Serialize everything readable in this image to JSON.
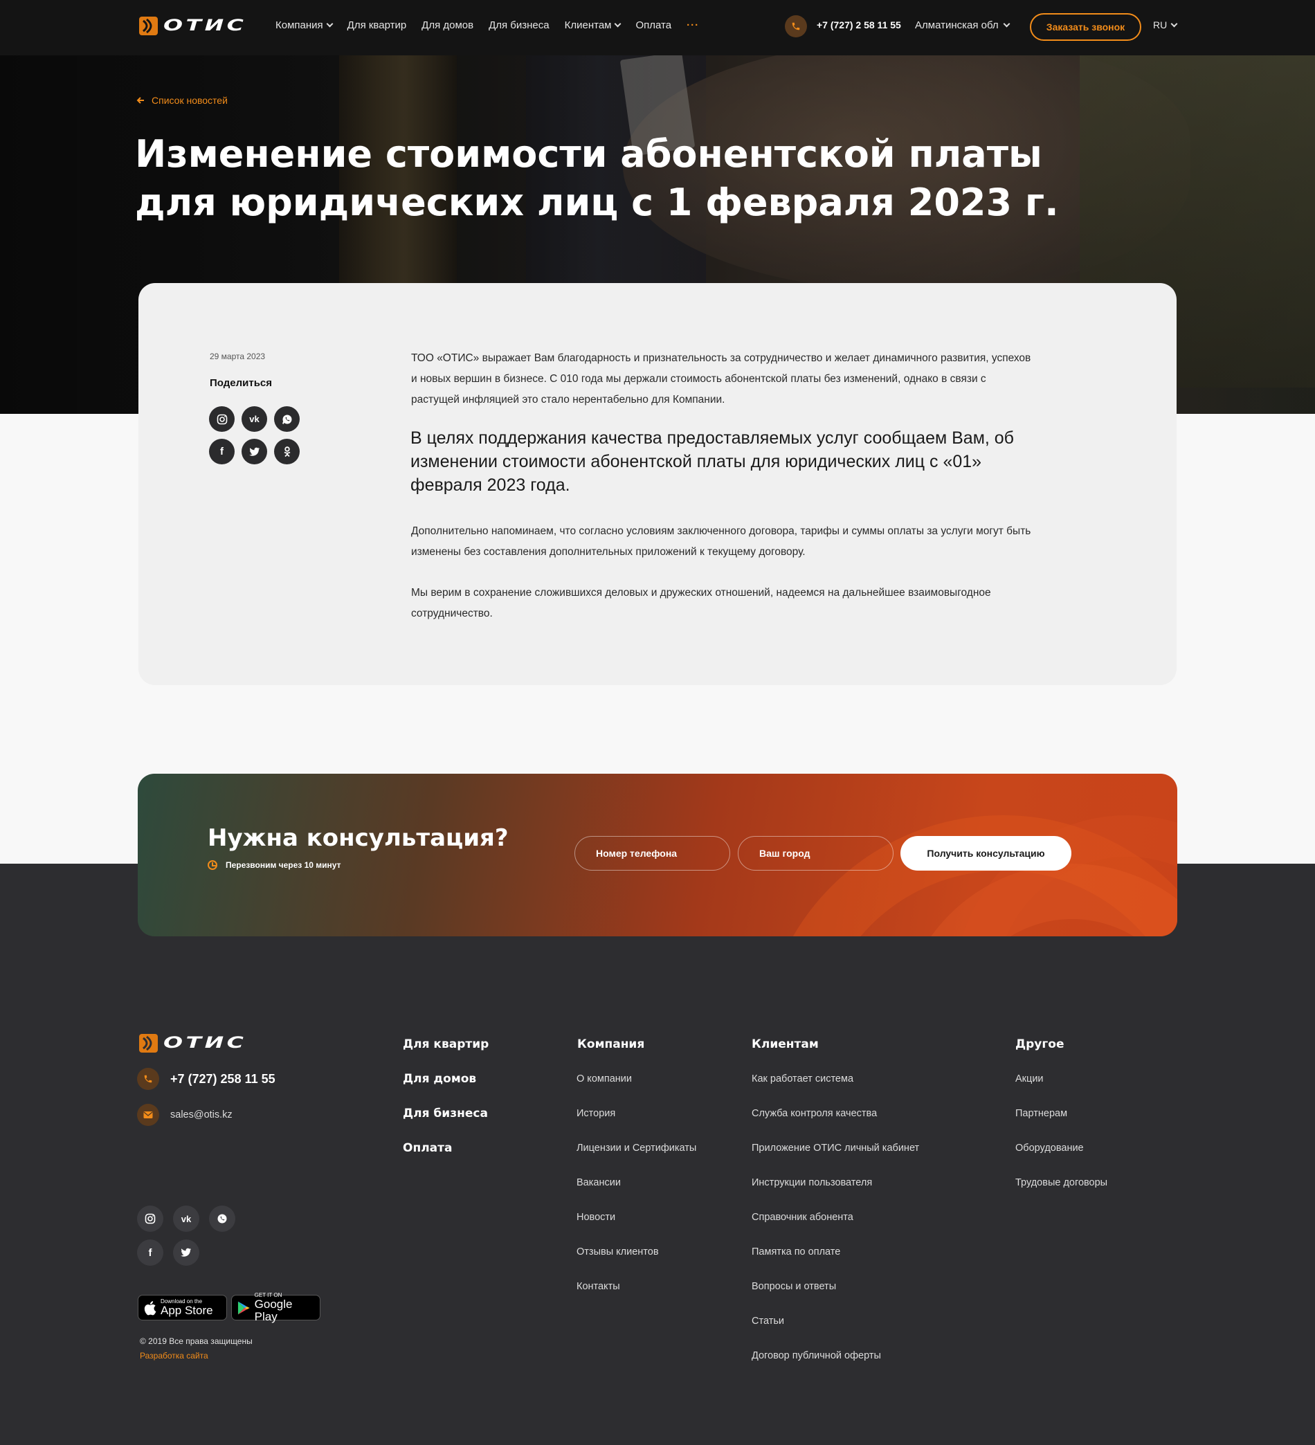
{
  "header": {
    "logo_text": "ОТИС",
    "nav": [
      {
        "label": "Компания",
        "dropdown": true
      },
      {
        "label": "Для квартир",
        "dropdown": false
      },
      {
        "label": "Для домов",
        "dropdown": false
      },
      {
        "label": "Для бизнеса",
        "dropdown": false
      },
      {
        "label": "Клиентам",
        "dropdown": true
      },
      {
        "label": "Оплата",
        "dropdown": false
      }
    ],
    "more": "···",
    "phone": "+7 (727) 2 58 11 55",
    "region": "Алматинская обл",
    "call_button": "Заказать звонок",
    "lang": "RU"
  },
  "hero": {
    "back_link": "Список новостей",
    "title_line1": "Изменение стоимости абонентской платы",
    "title_line2": "для юридических лиц с 1 февраля 2023 г."
  },
  "article": {
    "date": "29 марта 2023",
    "share_title": "Поделиться",
    "share_icons": [
      "instagram-icon",
      "vk-icon",
      "whatsapp-icon",
      "facebook-icon",
      "twitter-icon",
      "odnoklassniki-icon"
    ],
    "p1": "ТОО «ОТИС» выражает Вам благодарность и признательность за сотрудничество и желает динамичного развития, успехов и новых вершин в бизнесе. С 010 года мы держали стоимость абонентской платы без изменений, однако в связи с растущей инфляцией это стало нерентабельно для Компании.",
    "lead": "В целях поддержания качества предоставляемых услуг сообщаем Вам, об изменении стоимости абонентской платы для юридических лиц с «01» февраля 2023 года.",
    "p2": "Дополнительно напоминаем, что согласно условиям заключенного договора, тарифы и суммы оплаты за услуги могут быть изменены без составления дополнительных приложений к текущему договору.",
    "p3": "Мы верим в сохранение сложившихся деловых и дружеских отношений, надеемся на дальнейшее взаимовыгодное сотрудничество."
  },
  "consult": {
    "title": "Нужна консультация?",
    "subtitle": "Перезвоним через 10 минут",
    "phone_placeholder": "Номер телефона",
    "city_placeholder": "Ваш город",
    "button": "Получить консультацию"
  },
  "footer": {
    "logo_text": "ОТИС",
    "phone": "+7 (727) 258 11 55",
    "email": "sales@otis.kz",
    "social": [
      "instagram-icon",
      "vk-icon",
      "whatsapp-icon",
      "facebook-icon",
      "twitter-icon"
    ],
    "appstore_small": "Download on the",
    "appstore_big": "App Store",
    "googleplay_small": "GET IT ON",
    "googleplay_big": "Google Play",
    "copyright": "© 2019 Все права защищены",
    "dev": "Разработка сайта",
    "col1": [
      "Для квартир",
      "Для домов",
      "Для бизнеса",
      "Оплата"
    ],
    "col2_title": "Компания",
    "col2": [
      "О компании",
      "История",
      "Лицензии и Сертификаты",
      "Вакансии",
      "Новости",
      "Отзывы клиентов",
      "Контакты"
    ],
    "col3_title": "Клиентам",
    "col3": [
      "Как работает система",
      "Служба контроля качества",
      "Приложение ОТИС личный кабинет",
      "Инструкции пользователя",
      "Справочник абонента",
      "Памятка по оплате",
      "Вопросы и ответы",
      "Статьи",
      "Договор публичной оферты"
    ],
    "col4_title": "Другое",
    "col4": [
      "Акции",
      "Партнерам",
      "Оборудование",
      "Трудовые договоры"
    ]
  },
  "colors": {
    "accent": "#f28c1a",
    "dark": "#141414",
    "footer_bg": "#2d2d30",
    "card_bg": "#f0f0f0"
  }
}
